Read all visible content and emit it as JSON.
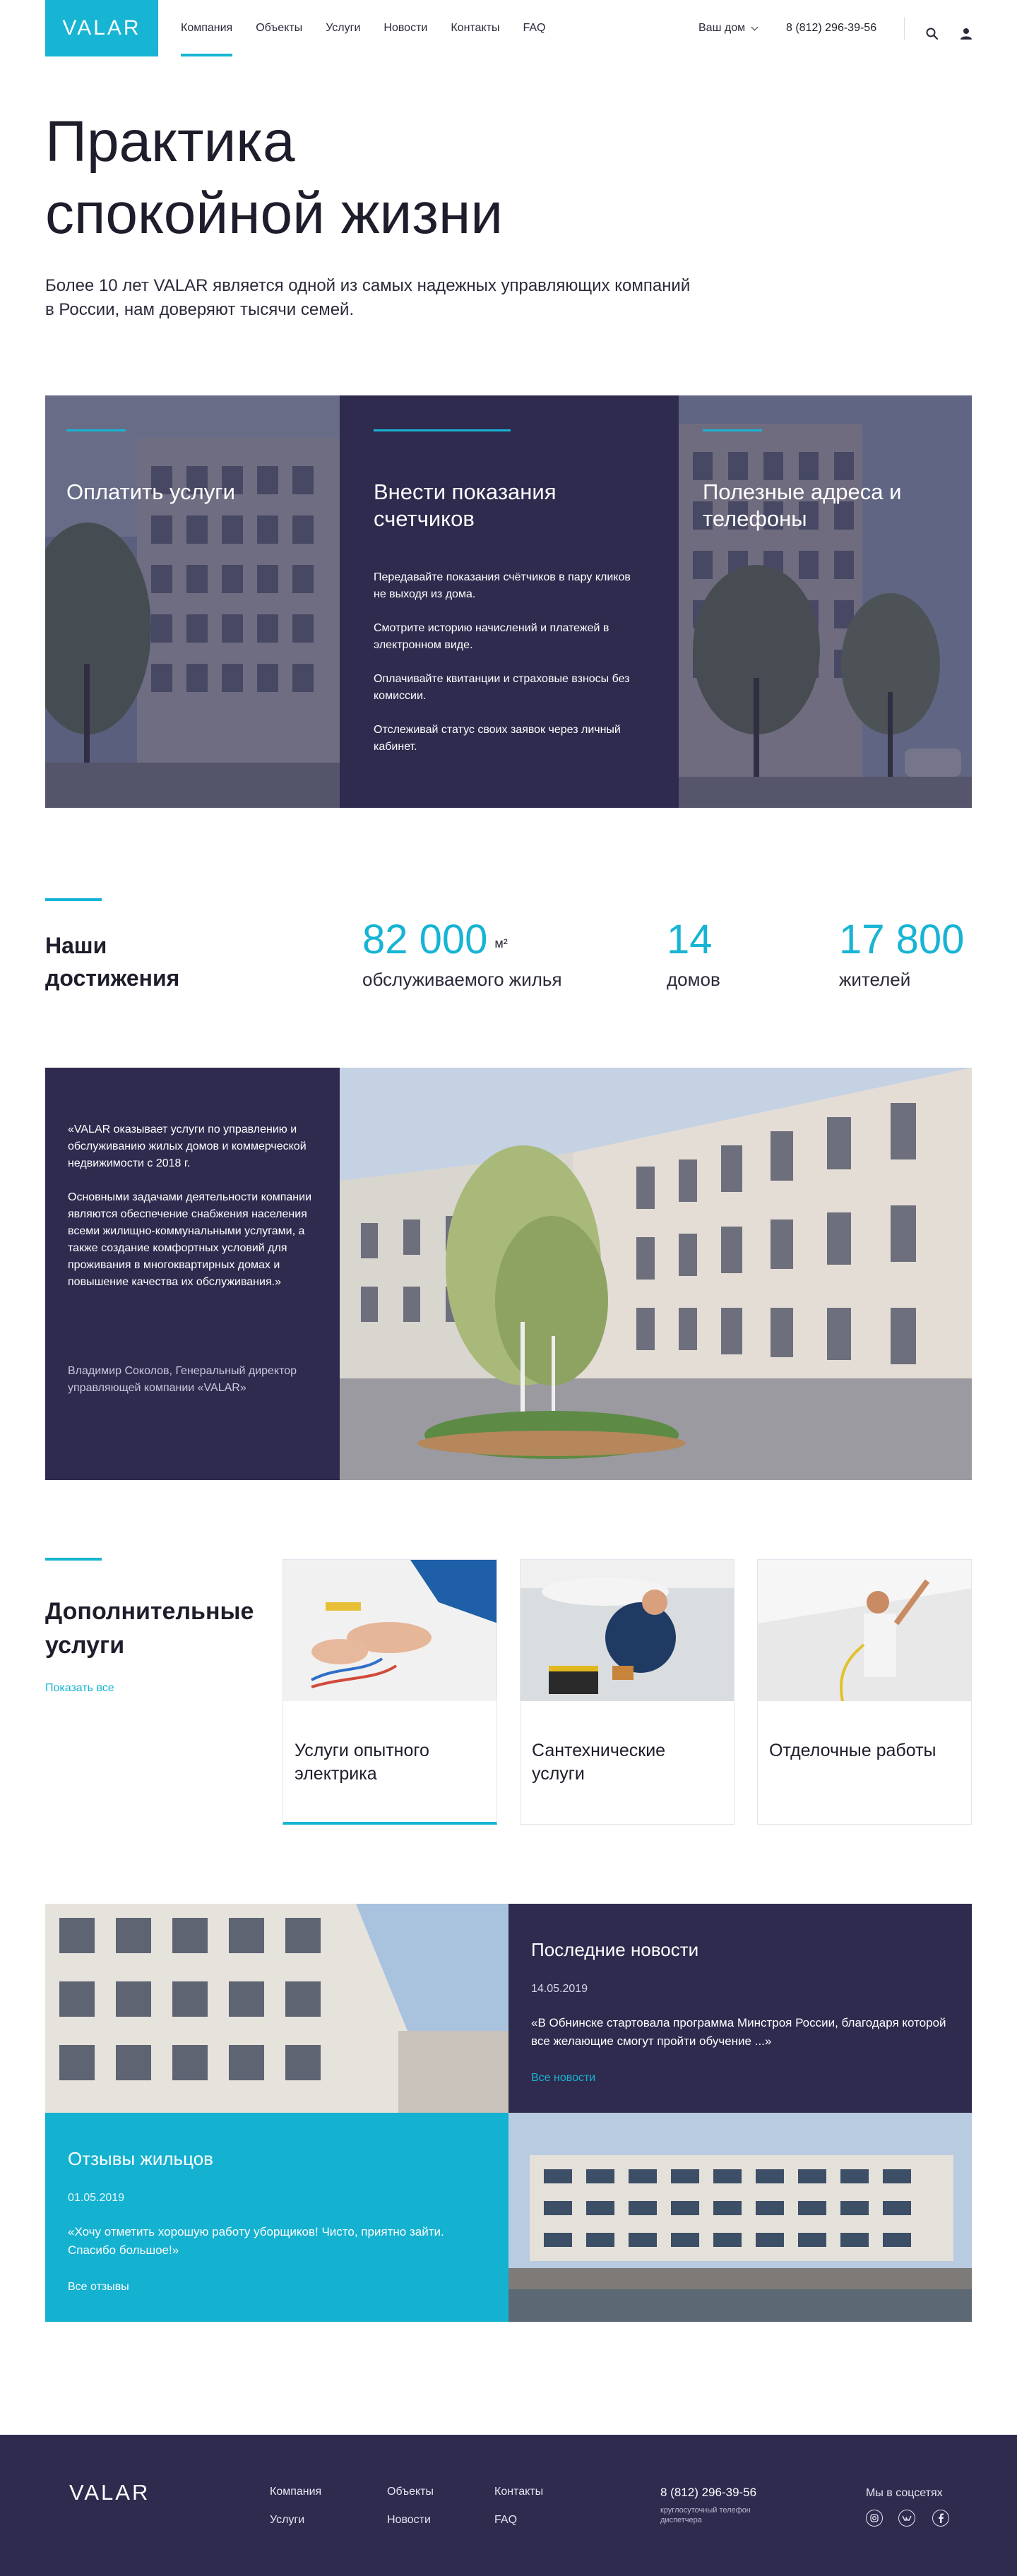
{
  "header": {
    "logo": "VALAR",
    "nav": [
      "Компания",
      "Объекты",
      "Услуги",
      "Новости",
      "Контакты",
      "FAQ"
    ],
    "home_select": "Ваш дом",
    "phone": "8 (812) 296-39-56",
    "icons": {
      "search": "search-icon",
      "user": "user-icon"
    }
  },
  "hero": {
    "title_line1": "Практика",
    "title_line2": "спокойной жизни",
    "subtitle": "Более 10 лет VALAR является одной из самых надежных управляющих компаний в России, нам доверяют тысячи семей."
  },
  "services": {
    "pay": {
      "title": "Оплатить услуги"
    },
    "meters": {
      "title": "Внести показания счетчиков",
      "items": [
        "Передавайте показания счётчиков в пару кликов не выходя из дома.",
        "Смотрите историю начислений и платежей в электронном виде.",
        "Оплачивайте квитанции и страховые взносы без комиссии.",
        "Отслеживай статус своих заявок через личный кабинет."
      ]
    },
    "addresses": {
      "title": "Полезные адреса и телефоны"
    }
  },
  "achievements": {
    "title": "Наши достижения",
    "stats": [
      {
        "value": "82 000",
        "unit": "м²",
        "label": "обслуживаемого жилья"
      },
      {
        "value": "14",
        "unit": "",
        "label": "домов"
      },
      {
        "value": "17 800",
        "unit": "",
        "label": "жителей"
      }
    ]
  },
  "quote": {
    "paragraph1": "«VALAR оказывает услуги по управлению и обслуживанию жилых домов и коммерческой недвижимости с 2018 г.",
    "paragraph2": "Основными задачами деятельности компании являются обеспечение снабжения населения всеми жилищно-коммунальными услугами, а также создание комфортных условий для проживания в многоквартирных домах и повышение качества их обслуживания.»",
    "author": "Владимир Соколов, Генеральный директор управляющей компании «VALAR»"
  },
  "additional": {
    "title": "Дополнительные услуги",
    "show_all": "Показать все",
    "cards": [
      {
        "title": "Услуги опытного электрика"
      },
      {
        "title": "Сантехнические услуги"
      },
      {
        "title": "Отделочные работы"
      }
    ]
  },
  "news": {
    "title": "Последние новости",
    "date": "14.05.2019",
    "text": "«В Обнинске стартовала программа Минстроя России, благодаря которой все желающие смогут пройти обучение ...»",
    "link": "Все новости"
  },
  "reviews": {
    "title": "Отзывы жильцов",
    "date": "01.05.2019",
    "text": "«Хочу отметить хорошую работу уборщиков! Чисто, приятно зайти. Спасибо большое!»",
    "link": "Все отзывы"
  },
  "footer": {
    "logo": "VALAR",
    "links": [
      "Компания",
      "Объекты",
      "Контакты",
      "Услуги",
      "Новости",
      "FAQ"
    ],
    "phone": "8 (812) 296-39-56",
    "phone_note": "круглосуточный телефон диспетчера",
    "social_label": "Мы в соцсетях",
    "socials": [
      "instagram-icon",
      "vk-icon",
      "facebook-icon"
    ]
  },
  "colors": {
    "accent": "#17b4d3",
    "dark": "#2f2b4f",
    "text": "#1d1d2b"
  }
}
